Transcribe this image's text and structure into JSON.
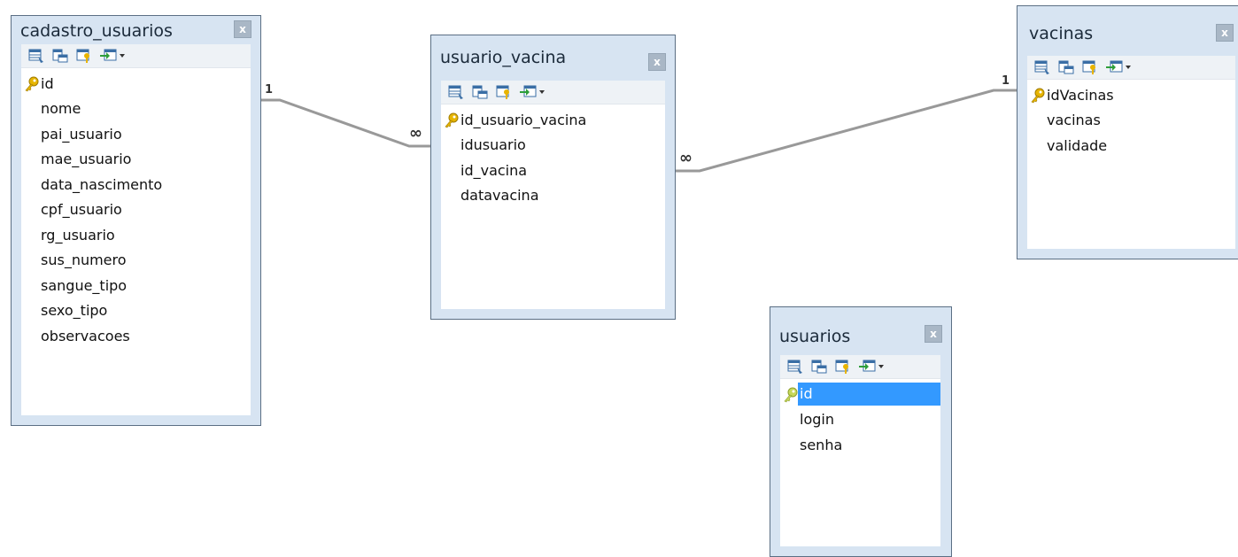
{
  "tables": [
    {
      "id": "cadastro_usuarios",
      "title": "cadastro_usuarios",
      "close_label": "x",
      "columns": [
        {
          "name": "id",
          "key": true
        },
        {
          "name": "nome"
        },
        {
          "name": "pai_usuario"
        },
        {
          "name": "mae_usuario"
        },
        {
          "name": "data_nascimento"
        },
        {
          "name": "cpf_usuario"
        },
        {
          "name": "rg_usuario"
        },
        {
          "name": "sus_numero"
        },
        {
          "name": "sangue_tipo"
        },
        {
          "name": "sexo_tipo"
        },
        {
          "name": "observacoes"
        }
      ]
    },
    {
      "id": "usuario_vacina",
      "title": "usuario_vacina",
      "close_label": "x",
      "columns": [
        {
          "name": "id_usuario_vacina",
          "key": true
        },
        {
          "name": "idusuario"
        },
        {
          "name": "id_vacina"
        },
        {
          "name": "datavacina"
        }
      ]
    },
    {
      "id": "vacinas",
      "title": "vacinas",
      "close_label": "x",
      "columns": [
        {
          "name": "idVacinas",
          "key": true
        },
        {
          "name": "vacinas"
        },
        {
          "name": "validade"
        }
      ]
    },
    {
      "id": "usuarios",
      "title": "usuarios",
      "close_label": "x",
      "columns": [
        {
          "name": "id",
          "key": true,
          "selected": true
        },
        {
          "name": "login"
        },
        {
          "name": "senha"
        }
      ]
    }
  ],
  "relationships": [
    {
      "from": "cadastro_usuarios",
      "to": "usuario_vacina",
      "from_label": "1",
      "to_label": "∞"
    },
    {
      "from": "usuario_vacina",
      "to": "vacinas",
      "from_label": "∞",
      "to_label": "1"
    }
  ],
  "colors": {
    "frame": "#d7e4f2",
    "frame_border": "#5b6f84",
    "line": "#999999",
    "selection": "#3399ff"
  },
  "icons": [
    "table-view-icon",
    "columns-icon",
    "keys-icon",
    "add-column-icon",
    "dropdown-arrow-icon",
    "primary-key-icon"
  ]
}
